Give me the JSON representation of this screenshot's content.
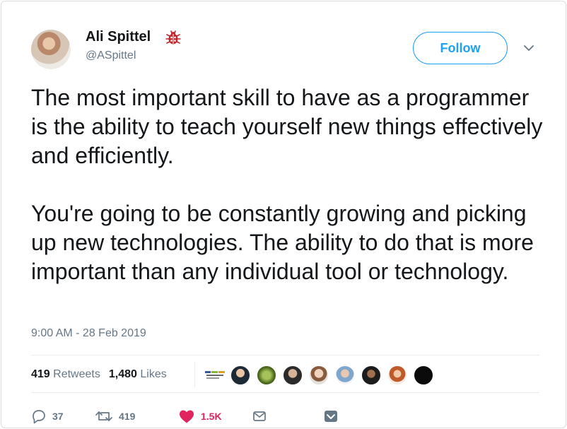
{
  "tweet": {
    "author_name": "Ali Spittel",
    "author_handle": "@ASpittel",
    "follow_label": "Follow",
    "paragraphs": [
      "The most important skill to have as a programmer is the ability to teach yourself new things effectively and efficiently.",
      "You're going to be constantly growing and picking up new technologies. The ability to do that is more important than any individual tool or technology."
    ],
    "timestamp": "9:00 AM - 28 Feb 2019",
    "retweets_count": "419",
    "retweets_label": "Retweets",
    "likes_count": "1,480",
    "likes_label": "Likes"
  },
  "actions": {
    "reply_count": "37",
    "retweet_count": "419",
    "like_count": "1.5K"
  },
  "icons": [
    "ladybug-icon",
    "chevron-down-icon",
    "reply-icon",
    "retweet-icon",
    "heart-icon",
    "message-icon",
    "save-icon"
  ],
  "colors": {
    "accent": "#1da1f2",
    "like": "#e0245e",
    "secondary_text": "#657786",
    "primary_text": "#14171a",
    "bug": "#c1272d"
  }
}
